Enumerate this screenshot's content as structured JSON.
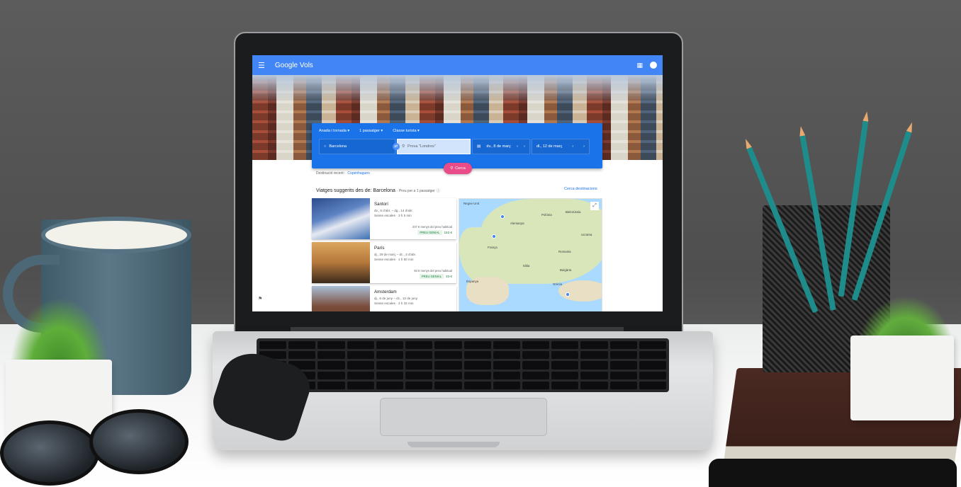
{
  "app": {
    "title": "Google Vols"
  },
  "search": {
    "trip_type": "Anada i tornada",
    "passengers": "1 passatger",
    "cabin": "Classe turista",
    "origin": "Barcelona",
    "destination_placeholder": "Prova \"Londres\"",
    "depart_date": "dv., 8 de març",
    "return_date": "dl., 12 de març",
    "search_button": "Cerca"
  },
  "recent": {
    "label": "Destinació recent:",
    "destination": "Copenhaguen"
  },
  "suggestions": {
    "title": "Viatges suggerits des de: Barcelona",
    "subtitle": "· Preu per a 1 passatger",
    "explore_link": "Cerca destinacions",
    "cards": [
      {
        "city": "Santorí",
        "dates": "dv., 6 d'abr. – dg., 14 d'abr.",
        "info": "Sense escales · 3 h 5 min",
        "saving": "237 € menys del preu habitual",
        "badge": "PREU GENIAL",
        "price": "153 €"
      },
      {
        "city": "París",
        "dates": "dj., 29 de març – dc., 3 d'abr.",
        "info": "Sense escales · 1 h 50 min",
        "saving": "93 € menys del preu habitual",
        "badge": "PREU GENIAL",
        "price": "33 €"
      },
      {
        "city": "Amsterdam",
        "dates": "dj., 6 de juny – dc., 12 de juny",
        "info": "Sense escales · 2 h 15 min"
      }
    ]
  },
  "map": {
    "labels": [
      "Regne Unit",
      "Polònia",
      "Bielorússia",
      "Alemanya",
      "Ucraïna",
      "França",
      "Romania",
      "Itàlia",
      "Bulgària",
      "Espanya",
      "Grècia"
    ]
  },
  "colors": {
    "appbar": "#4285f4",
    "search_panel": "#1a73e8",
    "search_button": "#ea4c89",
    "price_green": "#188038"
  },
  "icons": {
    "menu": "menu-icon",
    "apps": "apps-grid-icon",
    "account": "account-icon",
    "swap": "swap-icon",
    "location": "location-pin-icon",
    "calendar": "calendar-icon",
    "search": "search-icon",
    "info": "info-icon",
    "expand": "expand-icon",
    "feedback": "feedback-icon"
  }
}
